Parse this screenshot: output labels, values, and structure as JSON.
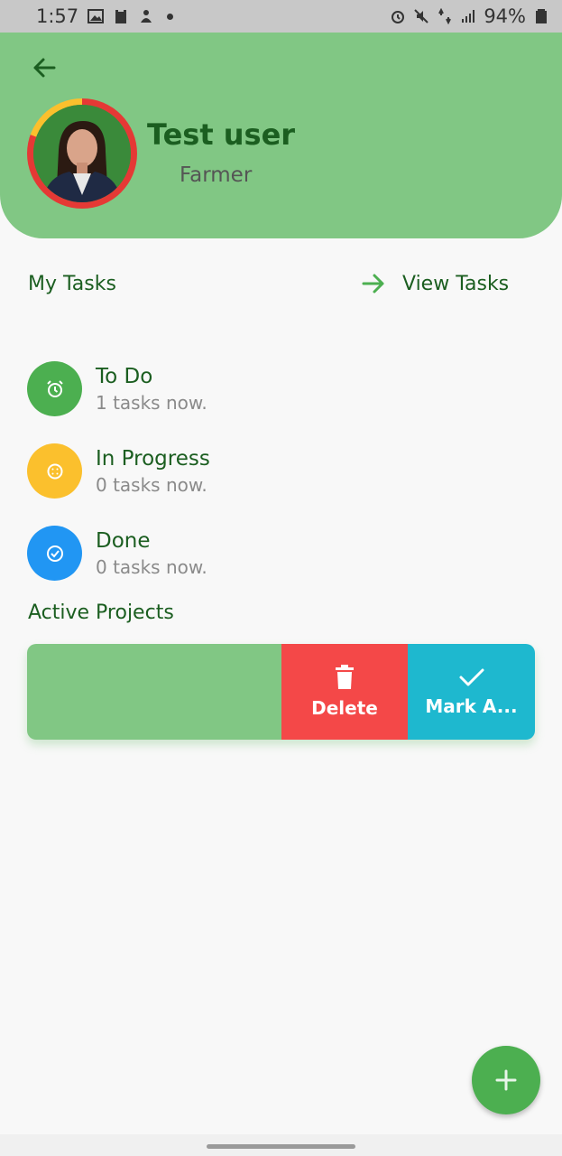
{
  "status_bar": {
    "time": "1:57",
    "battery": "94%"
  },
  "header": {
    "user_name": "Test user",
    "user_role": "Farmer"
  },
  "tasks_section": {
    "title": "My Tasks",
    "view_link": "View Tasks",
    "items": [
      {
        "label": "To Do",
        "count": "1 tasks now.",
        "color": "#4caf50",
        "icon": "alarm-icon"
      },
      {
        "label": "In Progress",
        "count": "0 tasks now.",
        "color": "#fbc02d",
        "icon": "progress-icon"
      },
      {
        "label": "Done",
        "count": "0 tasks now.",
        "color": "#2196f3",
        "icon": "check-circle-icon"
      }
    ]
  },
  "projects_section": {
    "title": "Active Projects",
    "actions": {
      "delete_label": "Delete",
      "mark_label": "Mark A..."
    }
  },
  "colors": {
    "header_bg": "#81c784",
    "primary": "#4caf50",
    "delete": "#f44848",
    "mark": "#1eb8cf",
    "text_green": "#1b5e20"
  }
}
